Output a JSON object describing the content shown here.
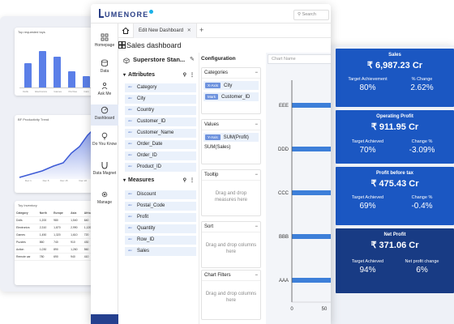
{
  "left_panel": {
    "chart1": {
      "title": "Top requested toys",
      "categories": [
        "Dolls",
        "Electronics",
        "Games",
        "Puzzles",
        "Cars"
      ]
    },
    "chart2": {
      "title": "BF Productivity Trend",
      "x_labels": [
        "Dec 1",
        "Dec 8",
        "Dec 15",
        "Dec 22"
      ]
    },
    "table": {
      "title": "Toy Inventory",
      "headers": [
        "Category",
        "North",
        "Europe",
        "Asia",
        "Africa"
      ],
      "rows": [
        [
          "Dolls",
          "1,200",
          "980",
          "1,540",
          "640"
        ],
        [
          "Electronics",
          "2,310",
          "1,870",
          "2,990",
          "1,120"
        ],
        [
          "Games",
          "1,450",
          "1,320",
          "1,610",
          "720"
        ],
        [
          "Puzzles",
          "860",
          "740",
          "910",
          "430"
        ],
        [
          "Action",
          "1,030",
          "890",
          "1,260",
          "560"
        ],
        [
          "Remote car",
          "780",
          "690",
          "940",
          "410"
        ]
      ]
    }
  },
  "kpi": {
    "sales": {
      "title": "Sales",
      "value": "₹ 6,987.23 Cr",
      "l1": "Target Achievement",
      "l2": "% Change",
      "v1": "80%",
      "v2": "2.62%"
    },
    "profit": {
      "title": "Operating Profit",
      "value": "₹ 911.95 Cr",
      "l1": "Target Achieved",
      "l2": "Change %",
      "v1": "70%",
      "v2": "-3.09%"
    },
    "pbt": {
      "title": "Profit before tax",
      "value": "₹ 475.43 Cr",
      "l1": "Target Achieved",
      "l2": "Change %",
      "v1": "69%",
      "v2": "-0.4%"
    },
    "net": {
      "title": "Net Profit",
      "value": "₹ 371.06 Cr",
      "l1": "Target Achieved",
      "l2": "Net profit change",
      "v1": "94%",
      "v2": "6%"
    }
  },
  "app": {
    "logo_rest": "UMENORE",
    "search_placeholder": "Search",
    "tab_label": "Edit New Dashboard",
    "dashboard_title": "Sales dashboard",
    "nav": [
      "Homepage",
      "Data",
      "Ask Me",
      "Dashboard",
      "Do You Know",
      "Data Magnet",
      "Manage"
    ],
    "dataset": "Superstore Stan...",
    "attributes_title": "Attributes",
    "attributes": [
      "Category",
      "City",
      "Country",
      "Customer_ID",
      "Customer_Name",
      "Order_Date",
      "Order_ID",
      "Product_ID"
    ],
    "measures_title": "Measures",
    "measures": [
      "Discount",
      "Postal_Code",
      "Profit",
      "Quantity",
      "Row_ID",
      "Sales"
    ],
    "config": {
      "title": "Configuration",
      "categories_label": "Categories",
      "cat_chips": [
        {
          "tag": "X-Axis",
          "name": "City"
        },
        {
          "tag": "Mark",
          "name": "Customer_ID"
        }
      ],
      "values_label": "Values",
      "val_chips": [
        {
          "tag": "Y-Axis",
          "name": "SUM(Profit)"
        }
      ],
      "val_plain": "SUM(Sales)",
      "tooltip_label": "Tooltip",
      "tooltip_hint": "Drag and drop measures here",
      "sort_label": "Sort",
      "sort_hint": "Drag and drop columns here",
      "filters_label": "Chart Filters",
      "filters_hint": "Drag and drop columns here"
    },
    "chart_name_placeholder": "Chart Name"
  },
  "chart_data": {
    "type": "bar",
    "orientation": "horizontal",
    "categories": [
      "EEE",
      "DDD",
      "CCC",
      "BBB",
      "AAA"
    ],
    "x_ticks": [
      "0",
      "50"
    ],
    "xlim": [
      0,
      50
    ],
    "color": "#3d7fd9"
  }
}
